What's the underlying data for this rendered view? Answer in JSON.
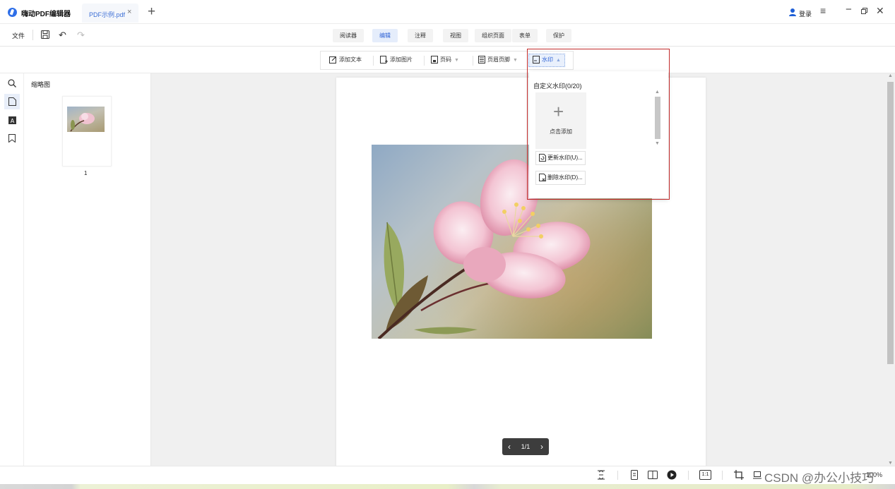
{
  "app": {
    "title": "嗨动PDF编辑器",
    "tab_label": "PDF示例.pdf",
    "tab_close": "×",
    "new_tab": "+",
    "login": "登录",
    "menu_glyph": "≡",
    "minimize_glyph": "−",
    "close_glyph": "✕",
    "accent": "#2f63d6"
  },
  "toolbar": {
    "file": "文件",
    "modes": [
      "阅读器",
      "编辑",
      "注释",
      "视图",
      "组织页面",
      "表单",
      "保护"
    ],
    "active_mode": "编辑"
  },
  "edit_tools": {
    "add_text": "添加文本",
    "add_image": "添加图片",
    "page_number": "页码",
    "header_footer": "页眉页脚",
    "watermark": "水印"
  },
  "sidebar": {
    "panel_title": "缩略图",
    "icons": [
      "search-icon",
      "page-icon",
      "text-icon",
      "bookmark-icon"
    ],
    "page_number": "1"
  },
  "document": {
    "pager_text": "1/1",
    "prev": "‹",
    "next": "›"
  },
  "watermark_menu": {
    "title": "自定义水印(0/20)",
    "add_plus": "+",
    "add_label": "点击添加",
    "update": "更新水印(U)...",
    "delete": "删除水印(D)...",
    "highlight_color": "#c22a2a"
  },
  "statusbar": {
    "zoom": "100%",
    "fit_label": "1:1",
    "watermark_text": "CSDN @办公小技巧"
  }
}
